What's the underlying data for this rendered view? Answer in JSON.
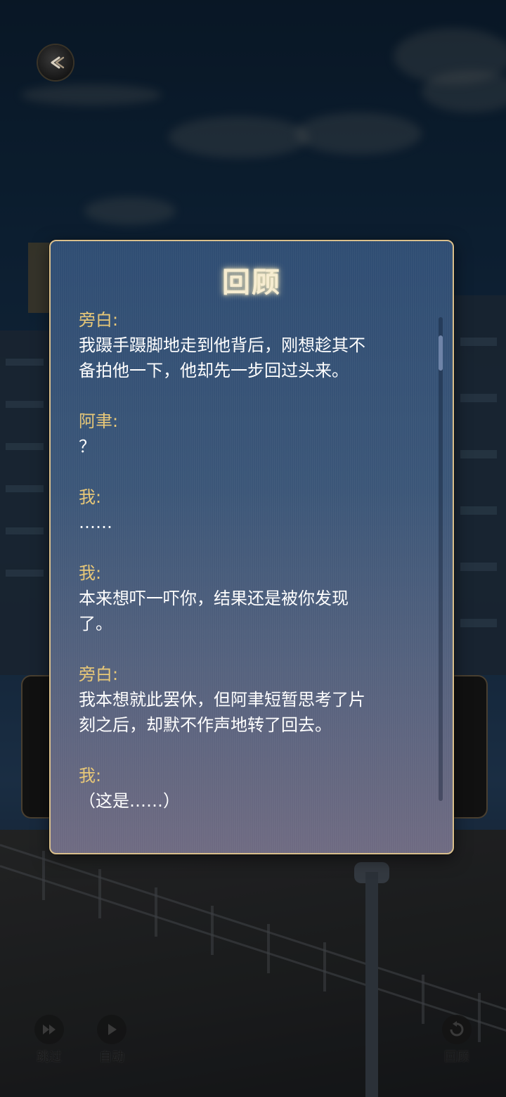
{
  "panel": {
    "title": "回顾"
  },
  "log": [
    {
      "speaker": "旁白:",
      "text": [
        "我蹑手蹑脚地走到他背后，刚想趁其不",
        "备拍他一下，他却先一步回过头来。"
      ]
    },
    {
      "speaker": "阿聿:",
      "text": [
        "？"
      ]
    },
    {
      "speaker": "我:",
      "text": [
        "……"
      ]
    },
    {
      "speaker": "我:",
      "text": [
        "本来想吓一吓你，结果还是被你发现",
        "了。"
      ]
    },
    {
      "speaker": "旁白:",
      "text": [
        "我本想就此罢休，但阿聿短暂思考了片",
        "刻之后，却默不作声地转了回去。"
      ]
    },
    {
      "speaker": "我:",
      "text": [
        "（这是……）"
      ]
    }
  ],
  "controls": {
    "skip": "跳过",
    "auto": "自动",
    "review": "回顾"
  },
  "icons": {
    "back": "back-arrow-icon",
    "skip": "fast-forward-icon",
    "auto": "play-icon",
    "review": "replay-icon"
  },
  "colors": {
    "speaker": "#e8c878",
    "text": "#ffffff",
    "border": "#d9bf8c",
    "title": "#f6ecd0"
  }
}
